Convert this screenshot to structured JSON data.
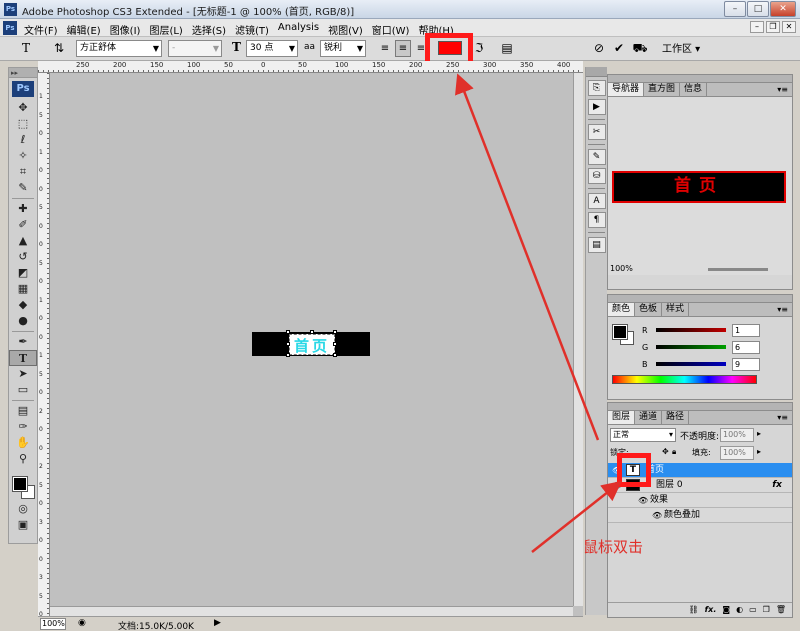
{
  "window": {
    "app_icon": "Ps",
    "title": "Adobe Photoshop CS3 Extended - [无标题-1 @ 100% (首页, RGB/8)]",
    "controls": [
      "minimize",
      "maximize",
      "close"
    ]
  },
  "menu": {
    "icon": "Ps",
    "items": [
      "文件(F)",
      "编辑(E)",
      "图像(I)",
      "图层(L)",
      "选择(S)",
      "滤镜(T)",
      "Analysis",
      "视图(V)",
      "窗口(W)",
      "帮助(H)"
    ]
  },
  "options_bar": {
    "font_family": "方正舒体",
    "font_style": "-",
    "font_size": "30 点",
    "aa_label": "aa",
    "antialias": "锐利",
    "text_color": "#ff0000",
    "workspace": "工作区"
  },
  "rulers": {
    "top_labels": [
      "250",
      "200",
      "150",
      "100",
      "50",
      "0",
      "50",
      "100",
      "150",
      "200",
      "250",
      "300",
      "350",
      "400"
    ],
    "left_labels": [
      "1",
      "5",
      "0",
      "1",
      "0",
      "0",
      "5",
      "0",
      "0",
      "5",
      "0",
      "1",
      "0",
      "0",
      "1",
      "5",
      "0",
      "2",
      "0",
      "0",
      "2",
      "5",
      "0",
      "3",
      "0",
      "0",
      "3",
      "5",
      "0"
    ]
  },
  "canvas": {
    "text": "首页",
    "background_color": "#000000",
    "text_color": "#29d8e6"
  },
  "status": {
    "zoom": "100%",
    "doc_info": "文档:15.0K/5.00K"
  },
  "navigator_panel": {
    "tabs": [
      "导航器",
      "直方图",
      "信息"
    ],
    "thumb_text": "首页",
    "zoom": "100%"
  },
  "color_panel": {
    "tabs": [
      "颜色",
      "色板",
      "样式"
    ],
    "channels": [
      {
        "label": "R",
        "value": "1",
        "color": "#c00000"
      },
      {
        "label": "G",
        "value": "6",
        "color": "#00a000"
      },
      {
        "label": "B",
        "value": "9",
        "color": "#0000c0"
      }
    ]
  },
  "layers_panel": {
    "tabs": [
      "图层",
      "通道",
      "路径"
    ],
    "blend_mode": "正常",
    "opacity_label": "不透明度:",
    "opacity": "100%",
    "lock_label": "锁定:",
    "fill_label": "填充:",
    "fill": "100%",
    "layers": [
      {
        "name": "首页",
        "type": "text",
        "selected": true
      },
      {
        "name": "图层 0",
        "type": "normal",
        "fx": "fx"
      },
      {
        "name": "效果",
        "type": "effects"
      },
      {
        "name": "颜色叠加",
        "type": "effect"
      }
    ],
    "thumb_glyph": "T"
  },
  "annotation": {
    "text": "鼠标双击",
    "color": "#e0302a"
  }
}
